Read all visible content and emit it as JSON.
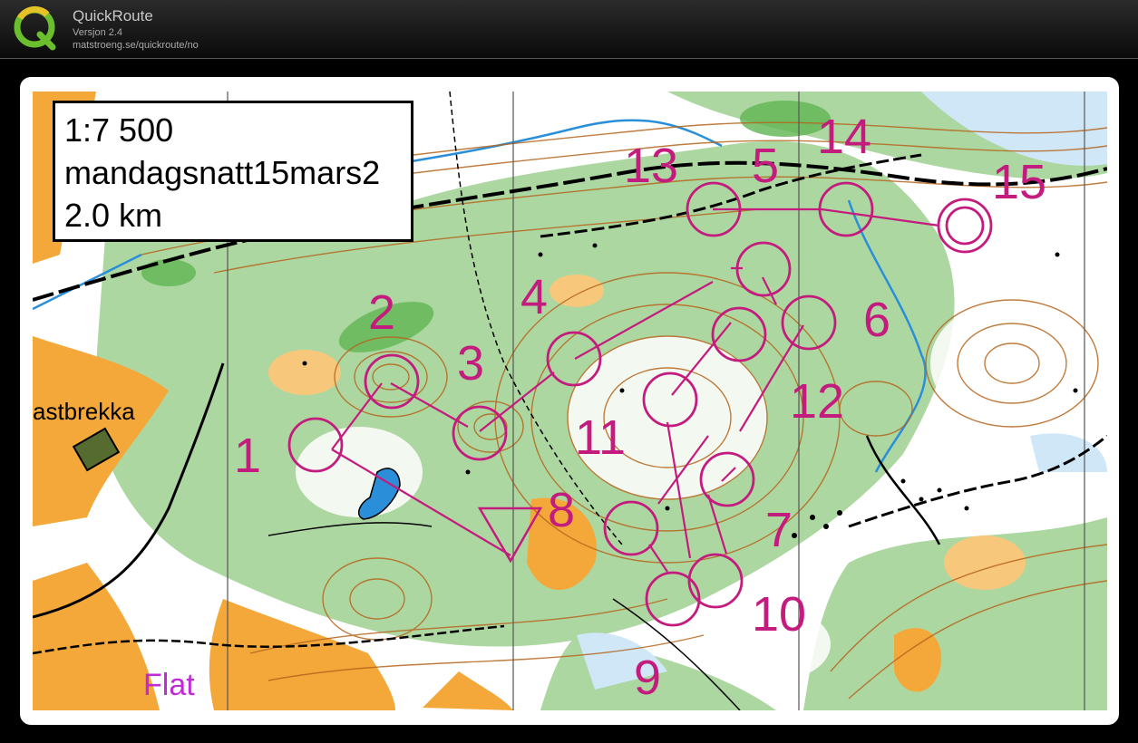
{
  "app": {
    "name": "QuickRoute",
    "version": "Versjon 2.4",
    "url": "matstroeng.se/quickroute/no"
  },
  "map_info": {
    "scale": "1:7 500",
    "event": "mandagsnatt15mars2",
    "distance": "2.0 km"
  },
  "place_names": {
    "astbrekka": "astbrekka",
    "flat": "Flat"
  },
  "course": {
    "color": "#c41b7e",
    "start_label": "",
    "control_numbers": [
      "1",
      "2",
      "3",
      "4",
      "5",
      "6",
      "7",
      "8",
      "9",
      "10",
      "11",
      "12",
      "13",
      "14",
      "15"
    ]
  },
  "colors": {
    "open_land": "#f4a83a",
    "forest_green": "#a8d49a",
    "contour": "#b5651d",
    "water": "#2a8fd8",
    "course": "#c41b7e"
  },
  "icons": [
    "quickroute-logo-icon"
  ]
}
